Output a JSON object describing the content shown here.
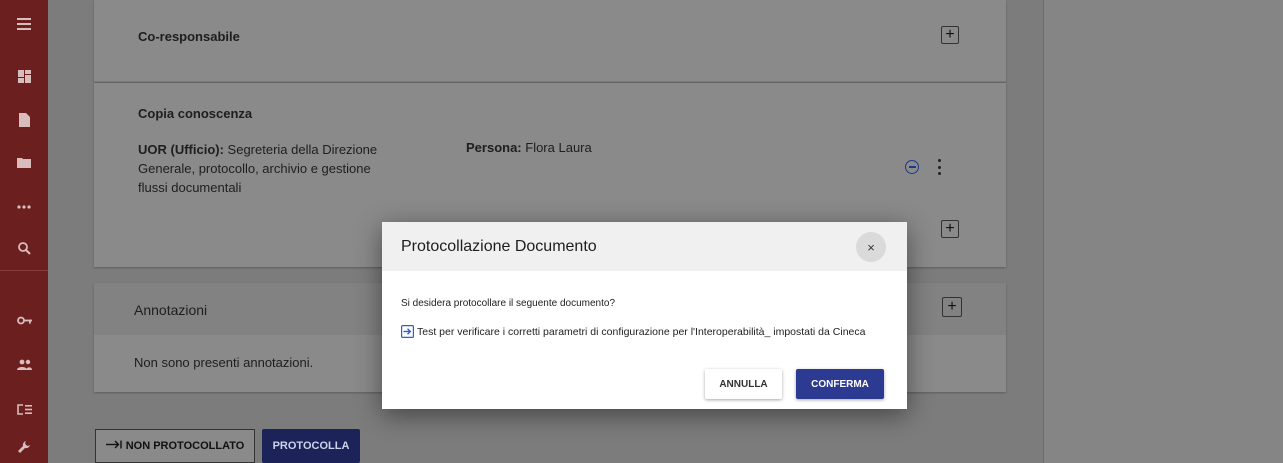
{
  "sidebar": {
    "icons": [
      "menu-icon",
      "dashboard-icon",
      "document-icon",
      "folder-icon",
      "more-horizontal-icon",
      "search-icon",
      "key-icon",
      "users-icon",
      "list-icon",
      "wrench-icon"
    ]
  },
  "sections": {
    "coresponsabile": {
      "title": "Co-responsabile"
    },
    "copia": {
      "title": "Copia conoscenza",
      "uor_label": "UOR (Ufficio):",
      "uor_value": " Segreteria della Direzione Generale, protocollo, archivio e gestione flussi documentali",
      "persona_label": "Persona:",
      "persona_value": " Flora Laura"
    },
    "annotazioni": {
      "title": "Annotazioni",
      "empty_text": "Non sono presenti annotazioni."
    }
  },
  "footer": {
    "non_protocollato": "NON PROTOCOLLATO",
    "protocolla": "PROTOCOLLA"
  },
  "modal": {
    "title": "Protocollazione Documento",
    "close": "×",
    "question": "Si desidera protocollare il seguente documento?",
    "document": "Test per verificare i corretti parametri di configurazione per l'Interoperabilità_ impostati da Cineca",
    "cancel": "ANNULLA",
    "confirm": "CONFERMA"
  },
  "colors": {
    "sidebar": "#6b1f1f",
    "primary": "#2c3a91"
  }
}
